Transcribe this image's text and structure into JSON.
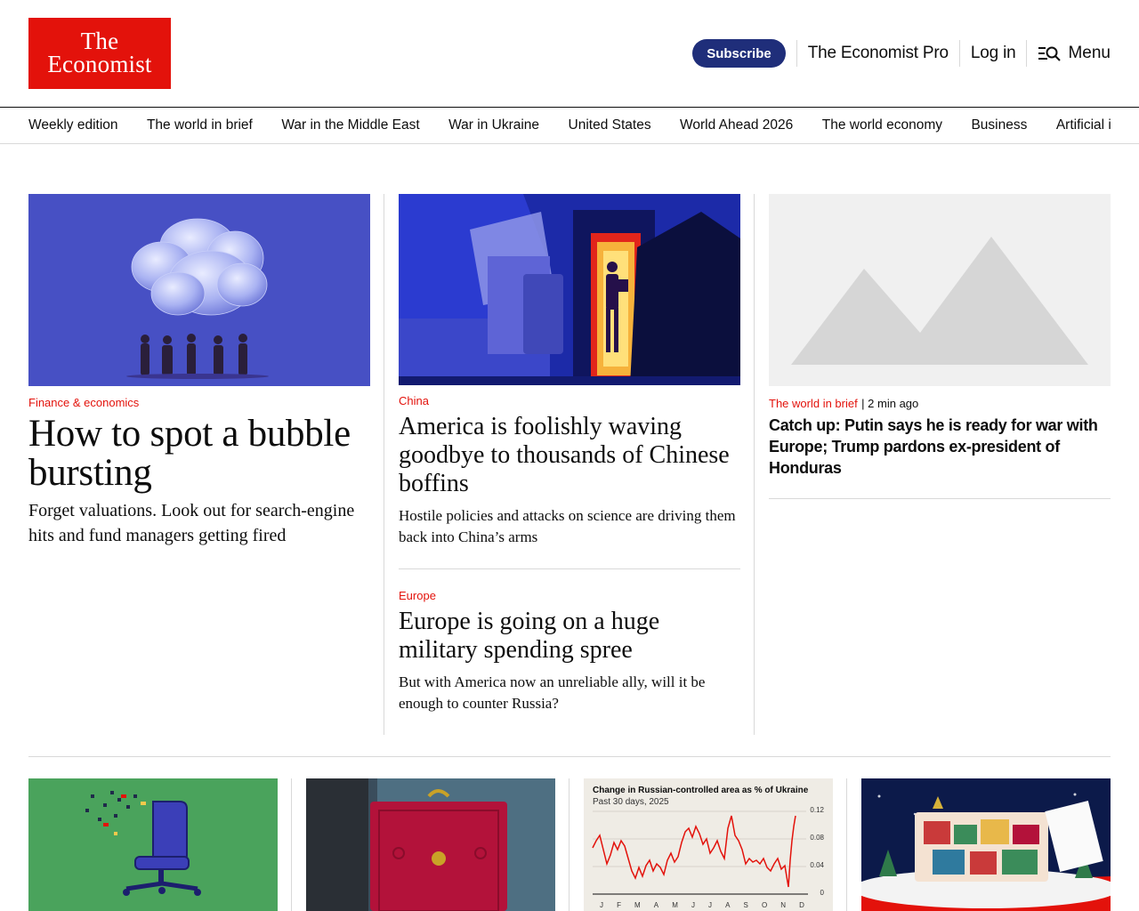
{
  "header": {
    "logo_line1": "The",
    "logo_line2": "Economist",
    "subscribe_label": "Subscribe",
    "pro_label": "The Economist Pro",
    "login_label": "Log in",
    "menu_label": "Menu"
  },
  "nav": {
    "items": [
      "Weekly edition",
      "The world in brief",
      "War in the Middle East",
      "War in Ukraine",
      "United States",
      "World Ahead 2026",
      "The world economy",
      "Business",
      "Artificial intellig"
    ]
  },
  "lead": {
    "rubric": "Finance & economics",
    "title": "How to spot a bubble bursting",
    "description": "Forget valuations. Look out for search-engine hits and fund managers getting fired"
  },
  "second": {
    "rubric": "China",
    "title": "America is foolishly waving goodbye to thousands of Chinese boffins",
    "description": "Hostile policies and attacks on science are driving them back into China’s arms"
  },
  "third": {
    "rubric": "Europe",
    "title": "Europe is going on a huge military spending spree",
    "description": "But with America now an unreliable ally, will it be enough to counter Russia?"
  },
  "brief": {
    "rubric": "The world in brief",
    "time": "2 min ago",
    "title": "Catch up: Putin says he is ready for war with Europe; Trump pardons ex-president of Honduras"
  },
  "mini_chart": {
    "title": "Change in Russian-controlled area as % of Ukraine",
    "subtitle": "Past 30 days, 2025",
    "y_ticks": [
      "0.12",
      "0.08",
      "0.04",
      "0"
    ],
    "x_ticks": [
      "J",
      "F",
      "M",
      "A",
      "M",
      "J",
      "J",
      "A",
      "S",
      "O",
      "N",
      "D"
    ]
  },
  "colors": {
    "brand_red": "#e3120b",
    "subscribe_blue": "#1f2e7a",
    "lead_image_bg": "#4750c4",
    "green_card_bg": "#4aa35c"
  }
}
